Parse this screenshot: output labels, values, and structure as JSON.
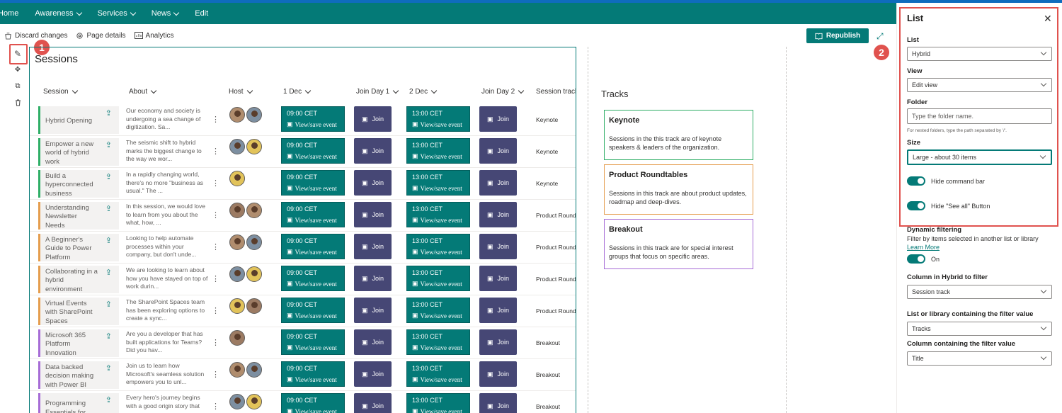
{
  "nav": {
    "items": [
      "Home",
      "Awareness",
      "Services",
      "News",
      "Edit"
    ]
  },
  "commands": {
    "discard": "Discard changes",
    "page_details": "Page details",
    "analytics": "Analytics",
    "republish": "Republish"
  },
  "badges": {
    "one": "1",
    "two": "2"
  },
  "webpart": {
    "title": "Sessions"
  },
  "columns": [
    "Session",
    "About",
    "Host",
    "1 Dec",
    "Join Day 1",
    "2 Dec",
    "Join Day 2",
    "Session track"
  ],
  "event": {
    "day1_time": "09:00 CET",
    "day2_time": "13:00 CET",
    "view": "View/save event",
    "join": "Join"
  },
  "rows": [
    {
      "session": "Hybrid Opening",
      "about": "Our economy and society is undergoing a sea change of digitization. Sa...",
      "track": "Keynote",
      "color": "#2fae66",
      "hosts": 2
    },
    {
      "session": "Empower a new world of hybrid work",
      "about": "The seismic shift to hybrid marks the biggest change to the way we wor...",
      "track": "Keynote",
      "color": "#2fae66",
      "hosts": 2
    },
    {
      "session": "Build a hyperconnected business",
      "about": "In a rapidly changing world, there's no more \"business as usual.\" The ...",
      "track": "Keynote",
      "color": "#2fae66",
      "hosts": 1
    },
    {
      "session": "Understanding Newsletter Needs",
      "about": "In this session, we would love to learn from you about the what, how, ...",
      "track": "Product Round",
      "color": "#e59d4e",
      "hosts": 2
    },
    {
      "session": "A Beginner's Guide to Power Platform",
      "about": "Looking to help automate processes within your company, but don't unde...",
      "track": "Product Round",
      "color": "#e59d4e",
      "hosts": 2
    },
    {
      "session": "Collaborating in a hybrid environment",
      "about": "We are looking to learn about how you have stayed on top of work durin...",
      "track": "Product Round",
      "color": "#e59d4e",
      "hosts": 2
    },
    {
      "session": "Virtual Events with SharePoint Spaces",
      "about": "The SharePoint Spaces team has been exploring options to create a sync...",
      "track": "Product Round",
      "color": "#e59d4e",
      "hosts": 2
    },
    {
      "session": "Microsoft 365 Platform Innovation",
      "about": "Are you a developer that has built applications for Teams? Did you hav...",
      "track": "Breakout",
      "color": "#a66cd6",
      "hosts": 1
    },
    {
      "session": "Data backed decision making with Power BI",
      "about": "Join us to learn how Microsoft's seamless solution empowers you to unl...",
      "track": "Breakout",
      "color": "#a66cd6",
      "hosts": 2
    },
    {
      "session": "Programming Essentials for",
      "about": "Every hero's journey begins with a good origin story that",
      "track": "Breakout",
      "color": "#a66cd6",
      "hosts": 2
    }
  ],
  "tracks": {
    "title": "Tracks",
    "cards": [
      {
        "name": "Keynote",
        "desc": "Sessions in the this track are of keynote speakers & leaders of the organization.",
        "color": "#2fae66"
      },
      {
        "name": "Product Roundtables",
        "desc": "Sessions in this track are about product updates, roadmap and deep-dives.",
        "color": "#e59d4e"
      },
      {
        "name": "Breakout",
        "desc": "Sessions in this track are for special interest groups that focus on specific areas.",
        "color": "#a66cd6"
      }
    ]
  },
  "panel": {
    "title": "List",
    "list_label": "List",
    "list_value": "Hybrid",
    "view_label": "View",
    "view_value": "Edit view",
    "folder_label": "Folder",
    "folder_placeholder": "Type the folder name.",
    "folder_hint": "For nested folders, type the path separated by '/'.",
    "size_label": "Size",
    "size_value": "Large - about 30 items",
    "hide_cmd": "Hide command bar",
    "hide_see_all": "Hide \"See all\" Button",
    "dyn_label": "Dynamic filtering",
    "dyn_desc": "Filter by items selected in another list or library",
    "learn_more": "Learn More",
    "on": "On",
    "col_filter_label": "Column in Hybrid to filter",
    "col_filter_value": "Session track",
    "list_lib_label": "List or library containing the filter value",
    "list_lib_value": "Tracks",
    "col_contain_label": "Column containing the filter value",
    "col_contain_value": "Title"
  }
}
